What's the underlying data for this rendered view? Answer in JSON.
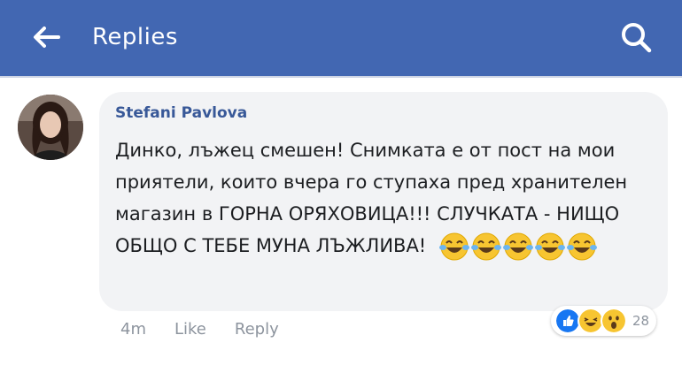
{
  "header": {
    "title": "Replies"
  },
  "comment": {
    "author": "Stefani Pavlova",
    "text": "Динко, лъжец смешен! Снимката е от пост на мои приятели, които вчера го ступаха пред хранителен магазин в ГОРНА ОРЯХОВИЦА!!! СЛУЧКАТА - НИЩО ОБЩО С ТЕБЕ МУНА ЛЪЖЛИВА!",
    "emoji": [
      "laughing-tears",
      "laughing-tears",
      "laughing-tears",
      "laughing-tears",
      "laughing-tears"
    ]
  },
  "actions": {
    "time": "4m",
    "like": "Like",
    "reply": "Reply"
  },
  "reactions": {
    "types": [
      "like",
      "haha",
      "wow"
    ],
    "count": "28"
  },
  "colors": {
    "header_bg": "#4267b2",
    "bubble_bg": "#f2f3f5",
    "author": "#385898",
    "meta": "#8d949e"
  }
}
